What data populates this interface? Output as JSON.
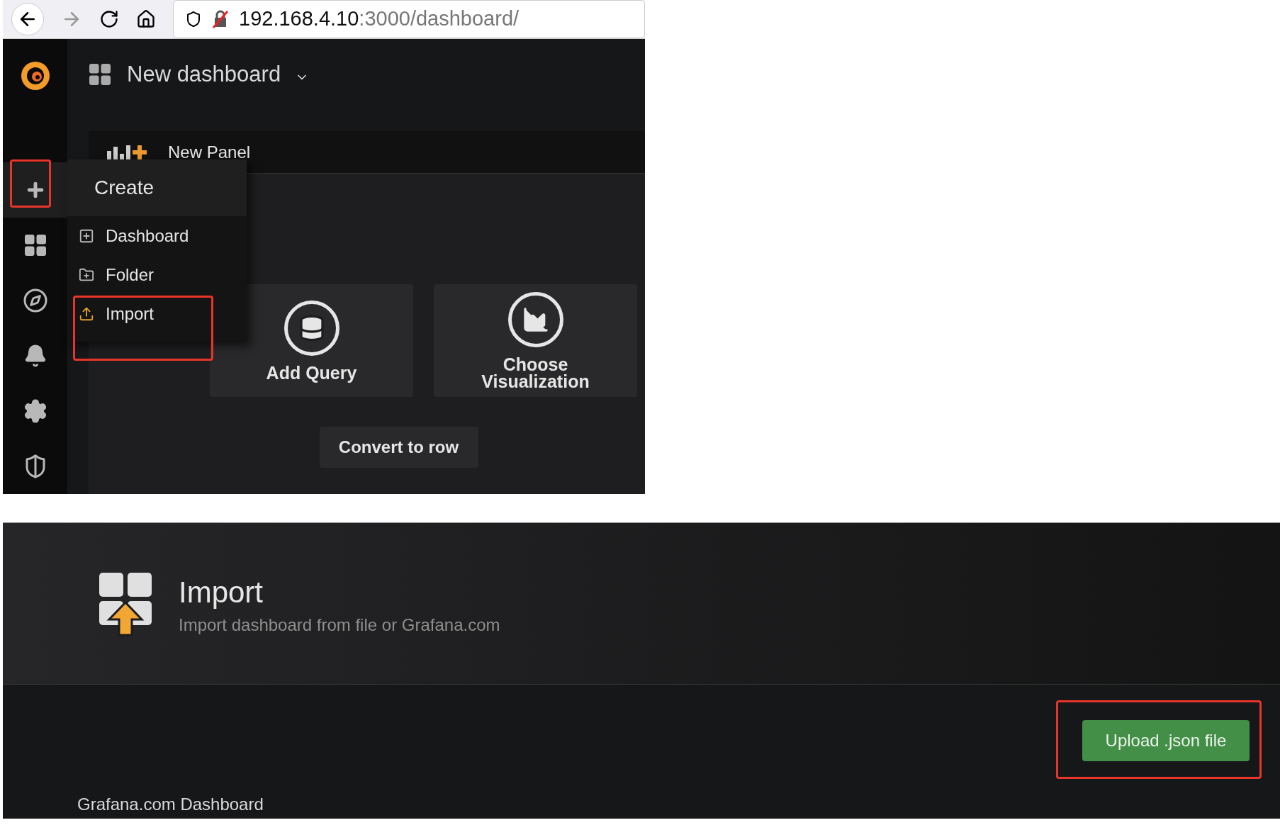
{
  "browser": {
    "url_host": "192.168.4.10",
    "url_path": ":3000/dashboard/"
  },
  "dashboard": {
    "title": "New dashboard",
    "panel_title": "New Panel",
    "convert_button": "Convert to row",
    "actions": [
      {
        "label": "Add Query",
        "kind": "query"
      },
      {
        "label": "Choose Visualization",
        "kind": "visualization"
      }
    ]
  },
  "sidebar": {
    "items": [
      {
        "kind": "create",
        "highlighted": true
      },
      {
        "kind": "dashboards",
        "highlighted": false
      },
      {
        "kind": "explore",
        "highlighted": false
      },
      {
        "kind": "alerting",
        "highlighted": false
      },
      {
        "kind": "configuration",
        "highlighted": false
      },
      {
        "kind": "admin",
        "highlighted": false
      }
    ]
  },
  "create_menu": {
    "title": "Create",
    "items": [
      {
        "label": "Dashboard",
        "kind": "dashboard",
        "highlighted": false
      },
      {
        "label": "Folder",
        "kind": "folder",
        "highlighted": false
      },
      {
        "label": "Import",
        "kind": "import",
        "highlighted": true
      }
    ]
  },
  "import_page": {
    "title": "Import",
    "subtitle": "Import dashboard from file or Grafana.com",
    "upload_button": {
      "label": "Upload .json file",
      "highlighted": true
    },
    "section_label": "Grafana.com Dashboard"
  }
}
